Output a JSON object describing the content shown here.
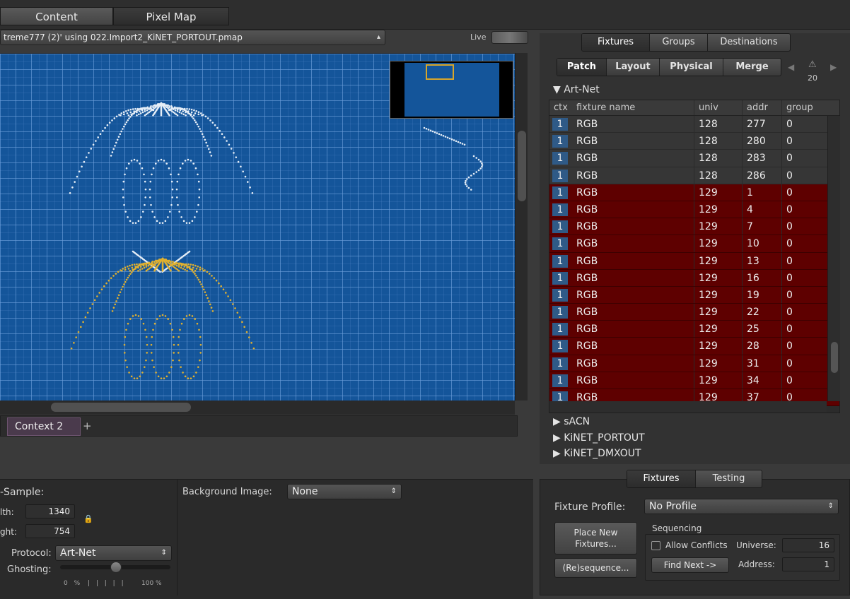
{
  "top_tabs": [
    "Content",
    "Pixel Map"
  ],
  "file_selector": {
    "value": "treme777 (2)' using 022.Import2_KiNET_PORTOUT.pmap"
  },
  "live_label": "Live",
  "context_tab": "Context 2",
  "left_panel": {
    "sample_label": "-Sample:",
    "width_label": "lth:",
    "width_value": "1340",
    "height_label": "ght:",
    "height_value": "754",
    "protocol_label": "Protocol:",
    "protocol_value": "Art-Net",
    "ghosting_label": "Ghosting:",
    "ghosting_min": "0 %",
    "ghosting_max": "100 %",
    "ghosting_value": 0.5,
    "background_label": "Background Image:",
    "background_value": "None"
  },
  "right_tabs": [
    "Fixtures",
    "Groups",
    "Destinations"
  ],
  "sub_tabs": [
    "Patch",
    "Layout",
    "Physical",
    "Merge"
  ],
  "warning_count": "20",
  "tree": {
    "artnet": "Art-Net",
    "others": [
      "sACN",
      "KiNET_PORTOUT",
      "KiNET_DMXOUT"
    ]
  },
  "table": {
    "headers": [
      "ctx",
      "fixture name",
      "univ",
      "addr",
      "group"
    ],
    "rows": [
      {
        "ctx": "1",
        "name": "RGB",
        "univ": "128",
        "addr": "277",
        "group": "0",
        "selected": false
      },
      {
        "ctx": "1",
        "name": "RGB",
        "univ": "128",
        "addr": "280",
        "group": "0",
        "selected": false
      },
      {
        "ctx": "1",
        "name": "RGB",
        "univ": "128",
        "addr": "283",
        "group": "0",
        "selected": false
      },
      {
        "ctx": "1",
        "name": "RGB",
        "univ": "128",
        "addr": "286",
        "group": "0",
        "selected": false
      },
      {
        "ctx": "1",
        "name": "RGB",
        "univ": "129",
        "addr": "1",
        "group": "0",
        "selected": true
      },
      {
        "ctx": "1",
        "name": "RGB",
        "univ": "129",
        "addr": "4",
        "group": "0",
        "selected": true
      },
      {
        "ctx": "1",
        "name": "RGB",
        "univ": "129",
        "addr": "7",
        "group": "0",
        "selected": true
      },
      {
        "ctx": "1",
        "name": "RGB",
        "univ": "129",
        "addr": "10",
        "group": "0",
        "selected": true
      },
      {
        "ctx": "1",
        "name": "RGB",
        "univ": "129",
        "addr": "13",
        "group": "0",
        "selected": true
      },
      {
        "ctx": "1",
        "name": "RGB",
        "univ": "129",
        "addr": "16",
        "group": "0",
        "selected": true
      },
      {
        "ctx": "1",
        "name": "RGB",
        "univ": "129",
        "addr": "19",
        "group": "0",
        "selected": true
      },
      {
        "ctx": "1",
        "name": "RGB",
        "univ": "129",
        "addr": "22",
        "group": "0",
        "selected": true
      },
      {
        "ctx": "1",
        "name": "RGB",
        "univ": "129",
        "addr": "25",
        "group": "0",
        "selected": true
      },
      {
        "ctx": "1",
        "name": "RGB",
        "univ": "129",
        "addr": "28",
        "group": "0",
        "selected": true
      },
      {
        "ctx": "1",
        "name": "RGB",
        "univ": "129",
        "addr": "31",
        "group": "0",
        "selected": true
      },
      {
        "ctx": "1",
        "name": "RGB",
        "univ": "129",
        "addr": "34",
        "group": "0",
        "selected": true
      },
      {
        "ctx": "1",
        "name": "RGB",
        "univ": "129",
        "addr": "37",
        "group": "0",
        "selected": true
      }
    ]
  },
  "bottom_tabs": [
    "Fixtures",
    "Testing"
  ],
  "fixture_profile": {
    "label": "Fixture Profile:",
    "value": "No Profile"
  },
  "place_button": "Place New Fixtures...",
  "resequence_button": "(Re)sequence...",
  "sequencing": {
    "title": "Sequencing",
    "allow_conflicts": "Allow Conflicts",
    "universe_label": "Universe:",
    "universe_value": "16",
    "find_next": "Find Next ->",
    "address_label": "Address:",
    "address_value": "1"
  },
  "colors": {
    "selected_row": "#5e0000",
    "canvas": "#14559a",
    "white_dots": "#e6eef7",
    "gold_dots": "#e0b030"
  }
}
